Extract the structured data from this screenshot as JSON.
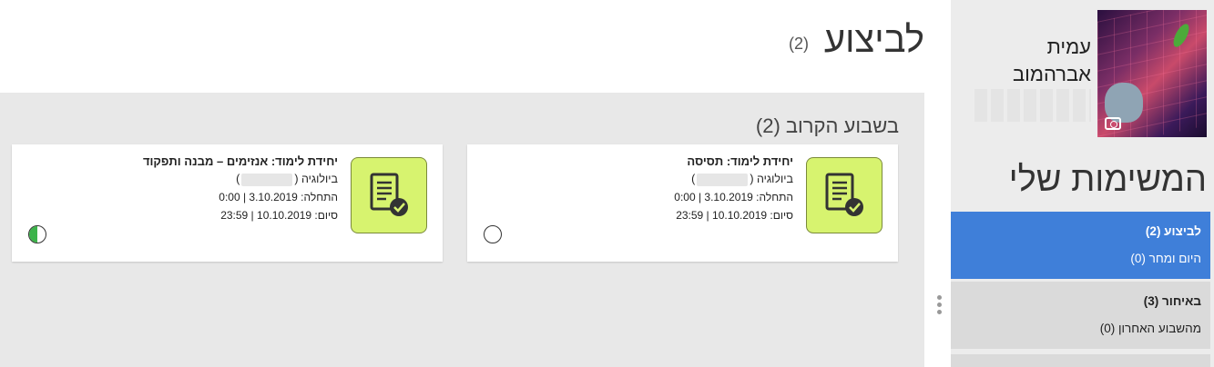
{
  "main": {
    "title": "לביצוע",
    "count": "(2)",
    "week_section": {
      "title": "בשבוע הקרוב (2)"
    },
    "cards": [
      {
        "title": "יחידת לימוד: תסיסה",
        "subject": "ביולוגיה (",
        "subject_close": ")",
        "start": "התחלה: 3.10.2019 | 0:00",
        "end": "סיום: 10.10.2019 | 23:59",
        "icon": "task-document-check-icon",
        "status": "not-started"
      },
      {
        "title": "יחידת לימוד: אנזימים – מבנה ותפקוד",
        "subject": "ביולוגיה (",
        "subject_close": ")",
        "start": "התחלה: 3.10.2019 | 0:00",
        "end": "סיום: 10.10.2019 | 23:59",
        "icon": "task-document-check-icon",
        "status": "in-progress"
      }
    ]
  },
  "sidebar": {
    "user": {
      "first_name": "עמית",
      "last_name": "אברהמוב"
    },
    "heading": "המשימות שלי",
    "nav": [
      {
        "title": "לביצוע (2)",
        "subtitle": "היום ומחר (0)",
        "active": true
      },
      {
        "title": "באיחור (3)",
        "subtitle": "מהשבוע האחרון (0)",
        "active": false
      }
    ]
  },
  "colors": {
    "accent": "#3f7fd9",
    "card_icon_bg": "#d7f36f",
    "progress_green": "#3cb34a",
    "panel_bg": "#e8e8e8"
  }
}
